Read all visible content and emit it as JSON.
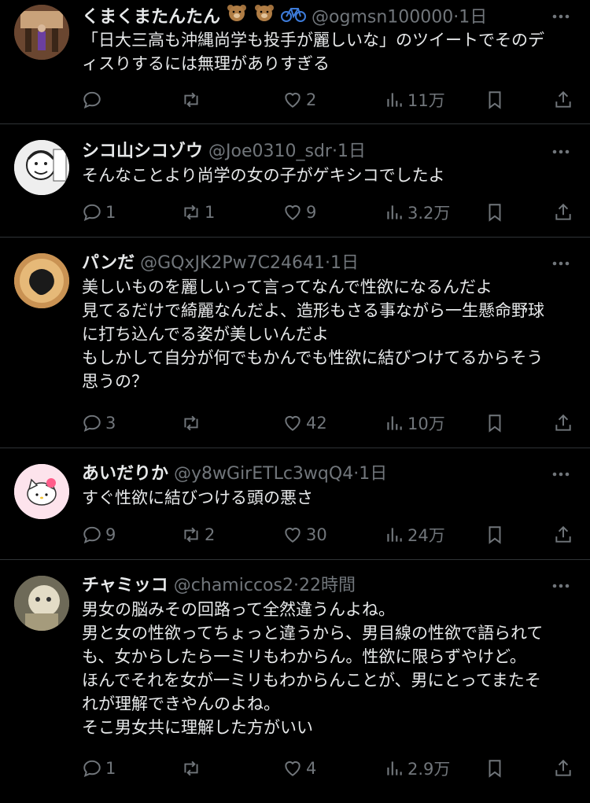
{
  "tweets": [
    {
      "name": "くまくまたんたん",
      "handle": "@ogmsn100000",
      "sep": "·",
      "time": "1日",
      "lines": [
        "「日大三高も沖縄尚学も投手が麗しいな」のツイートでそのデ",
        "ィスりするには無理がありすぎる"
      ],
      "replies": "",
      "retweets": "",
      "likes": "2",
      "views": "11万"
    },
    {
      "name": "シコ山シコゾウ",
      "handle": "@Joe0310_sdr",
      "sep": "·",
      "time": "1日",
      "lines": [
        "そんなことより尚学の女の子がゲキシコでしたよ"
      ],
      "replies": "1",
      "retweets": "1",
      "likes": "9",
      "views": "3.2万"
    },
    {
      "name": "パンだ",
      "handle": "@GQxJK2Pw7C24641",
      "sep": "·",
      "time": "1日",
      "lines": [
        "美しいものを麗しいって言ってなんで性欲になるんだよ",
        "見てるだけで綺麗なんだよ、造形もさる事ながら一生懸命野球",
        "に打ち込んでる姿が美しいんだよ",
        "もしかして自分が何でもかんでも性欲に結びつけてるからそう",
        "思うの？"
      ],
      "replies": "3",
      "retweets": "",
      "likes": "42",
      "views": "10万"
    },
    {
      "name": "あいだりか",
      "handle": "@y8wGirETLc3wqQ4",
      "sep": "·",
      "time": "1日",
      "lines": [
        "すぐ性欲に結びつける頭の悪さ"
      ],
      "replies": "9",
      "retweets": "2",
      "likes": "30",
      "views": "24万"
    },
    {
      "name": "チャミッコ",
      "handle": "@chamiccos2",
      "sep": "·",
      "time": "22時間",
      "lines": [
        "男女の脳みその回路って全然違うんよね。",
        "男と女の性欲ってちょっと違うから、男目線の性欲で語られて",
        "も、女からしたら一ミリもわからん。性欲に限らずやけど。",
        "ほんでそれを女が一ミリもわからんことが、男にとってまたそ",
        "れが理解できやんのよね。",
        "そこ男女共に理解した方がいい"
      ],
      "replies": "1",
      "retweets": "",
      "likes": "4",
      "views": "2.9万"
    }
  ],
  "icons": {
    "reply": "reply-icon",
    "retweet": "retweet-icon",
    "like": "heart-icon",
    "views": "views-icon",
    "bookmark": "bookmark-icon",
    "share": "share-icon",
    "more": "more-icon"
  },
  "colors": {
    "background": "#000000",
    "text": "#e7e9ea",
    "muted": "#71767b",
    "divider": "#2f3336"
  }
}
